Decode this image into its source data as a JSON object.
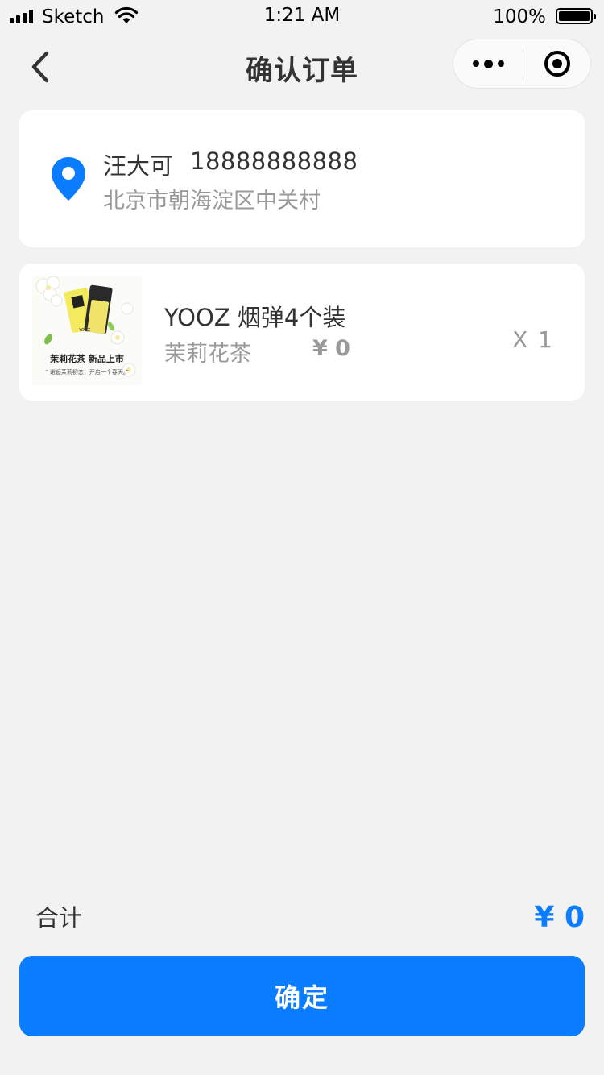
{
  "status_bar": {
    "carrier": "Sketch",
    "time": "1:21 AM",
    "battery": "100%"
  },
  "nav": {
    "title": "确认订单"
  },
  "address": {
    "name": "汪大可",
    "phone": "18888888888",
    "detail": "北京市朝海淀区中关村"
  },
  "product": {
    "name": "YOOZ 烟弹4个装",
    "flavor": "茉莉花茶",
    "price": "¥ 0",
    "quantity": "X 1",
    "image_caption": "茉莉花茶  新品上市",
    "image_subcaption": "“ 邂逅茉莉初恋，开启一个春天。”",
    "image_brand": "YOOZ"
  },
  "footer": {
    "total_label": "合计",
    "total_amount": "¥ 0",
    "confirm_label": "确定"
  },
  "colors": {
    "accent": "#0a7cff",
    "background": "#f2f2f2",
    "card": "#ffffff",
    "muted_text": "#999999"
  }
}
